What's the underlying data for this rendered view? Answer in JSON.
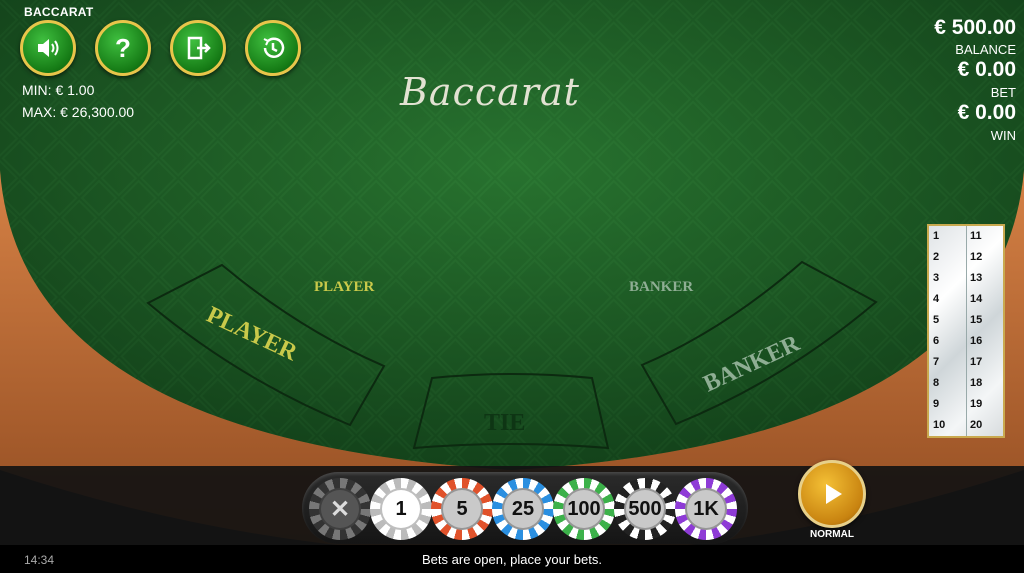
{
  "game": {
    "name": "BACCARAT",
    "table_title": "Baccarat"
  },
  "limits": {
    "min": "MIN: € 1.00",
    "max": "MAX: € 26,300.00"
  },
  "balance": {
    "value": "€ 500.00",
    "label": "BALANCE"
  },
  "bet": {
    "value": "€ 0.00",
    "label": "BET"
  },
  "win": {
    "value": "€ 0.00",
    "label": "WIN"
  },
  "toolbar": [
    {
      "name": "sound-button",
      "icon": "speaker-icon"
    },
    {
      "name": "help-button",
      "icon": "question-icon"
    },
    {
      "name": "exit-button",
      "icon": "exit-door-icon"
    },
    {
      "name": "history-button",
      "icon": "history-clock-icon"
    }
  ],
  "areas": {
    "player_label": "PLAYER",
    "banker_label": "BANKER",
    "player_zone": "PLAYER",
    "banker_zone": "BANKER",
    "tie_zone": "TIE"
  },
  "colors": {
    "felt": "#1f6b2a",
    "rail": "#c9733f",
    "player_text": "#c9c94a",
    "banker_text": "#8fae94",
    "gold": "#e8c54a"
  },
  "history": {
    "left": [
      "1",
      "2",
      "3",
      "4",
      "5",
      "6",
      "7",
      "8",
      "9",
      "10"
    ],
    "right": [
      "11",
      "12",
      "13",
      "14",
      "15",
      "16",
      "17",
      "18",
      "19",
      "20"
    ]
  },
  "chips": [
    {
      "name": "clear-bets-chip",
      "label": "✕"
    },
    {
      "name": "chip-1",
      "label": "1"
    },
    {
      "name": "chip-5",
      "label": "5"
    },
    {
      "name": "chip-25",
      "label": "25"
    },
    {
      "name": "chip-100",
      "label": "100"
    },
    {
      "name": "chip-500",
      "label": "500"
    },
    {
      "name": "chip-1k",
      "label": "1K"
    }
  ],
  "play": {
    "speed_label": "NORMAL"
  },
  "status": {
    "time": "14:34",
    "message": "Bets are open, place your bets."
  }
}
